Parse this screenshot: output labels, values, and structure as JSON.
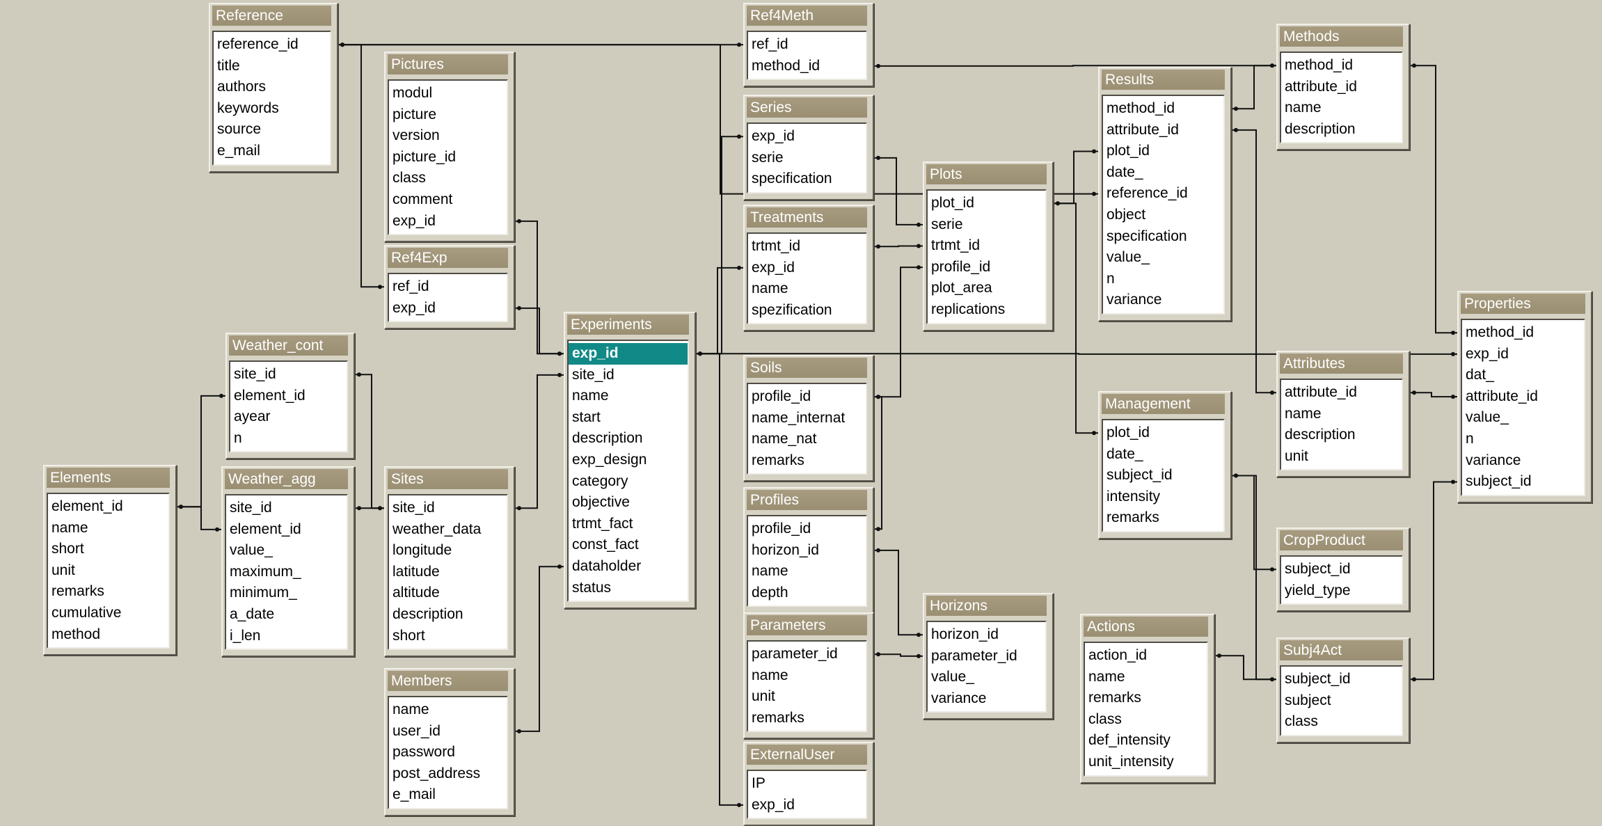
{
  "selected_field": {
    "table": "experiments",
    "field": "exp_id"
  },
  "colors": {
    "canvas": "#cfcbbd",
    "title_bar": "#a09478",
    "selection": "#118a87",
    "relationship_line": "#111111"
  },
  "tables": [
    {
      "id": "reference",
      "title": "Reference",
      "fields": [
        "reference_id",
        "title",
        "authors",
        "keywords",
        "source",
        "e_mail"
      ]
    },
    {
      "id": "pictures",
      "title": "Pictures",
      "fields": [
        "modul",
        "picture",
        "version",
        "picture_id",
        "class",
        "comment",
        "exp_id"
      ]
    },
    {
      "id": "ref4exp",
      "title": "Ref4Exp",
      "fields": [
        "ref_id",
        "exp_id"
      ]
    },
    {
      "id": "ref4meth",
      "title": "Ref4Meth",
      "fields": [
        "ref_id",
        "method_id"
      ]
    },
    {
      "id": "series",
      "title": "Series",
      "fields": [
        "exp_id",
        "serie",
        "specification"
      ]
    },
    {
      "id": "treatments",
      "title": "Treatments",
      "fields": [
        "trtmt_id",
        "exp_id",
        "name",
        "spezification"
      ]
    },
    {
      "id": "plots",
      "title": "Plots",
      "fields": [
        "plot_id",
        "serie",
        "trtmt_id",
        "profile_id",
        "plot_area",
        "replications"
      ]
    },
    {
      "id": "results",
      "title": "Results",
      "fields": [
        "method_id",
        "attribute_id",
        "plot_id",
        "date_",
        "reference_id",
        "object",
        "specification",
        "value_",
        "n",
        "variance"
      ]
    },
    {
      "id": "methods",
      "title": "Methods",
      "fields": [
        "method_id",
        "attribute_id",
        "name",
        "description"
      ]
    },
    {
      "id": "properties",
      "title": "Properties",
      "fields": [
        "method_id",
        "exp_id",
        "dat_",
        "attribute_id",
        "value_",
        "n",
        "variance",
        "subject_id"
      ]
    },
    {
      "id": "attributes",
      "title": "Attributes",
      "fields": [
        "attribute_id",
        "name",
        "description",
        "unit"
      ]
    },
    {
      "id": "experiments",
      "title": "Experiments",
      "fields": [
        "exp_id",
        "site_id",
        "name",
        "start",
        "description",
        "exp_design",
        "category",
        "objective",
        "trtmt_fact",
        "const_fact",
        "dataholder",
        "status"
      ]
    },
    {
      "id": "weather_cont",
      "title": "Weather_cont",
      "fields": [
        "site_id",
        "element_id",
        "ayear",
        "n"
      ]
    },
    {
      "id": "weather_agg",
      "title": "Weather_agg",
      "fields": [
        "site_id",
        "element_id",
        "value_",
        "maximum_",
        "minimum_",
        "a_date",
        "i_len"
      ]
    },
    {
      "id": "elements",
      "title": "Elements",
      "fields": [
        "element_id",
        "name",
        "short",
        "unit",
        "remarks",
        "cumulative",
        "method"
      ]
    },
    {
      "id": "sites",
      "title": "Sites",
      "fields": [
        "site_id",
        "weather_data",
        "longitude",
        "latitude",
        "altitude",
        "description",
        "short"
      ]
    },
    {
      "id": "members",
      "title": "Members",
      "fields": [
        "name",
        "user_id",
        "password",
        "post_address",
        "e_mail"
      ]
    },
    {
      "id": "soils",
      "title": "Soils",
      "fields": [
        "profile_id",
        "name_internat",
        "name_nat",
        "remarks"
      ]
    },
    {
      "id": "profiles",
      "title": "Profiles",
      "fields": [
        "profile_id",
        "horizon_id",
        "name",
        "depth"
      ]
    },
    {
      "id": "parameters",
      "title": "Parameters",
      "fields": [
        "parameter_id",
        "name",
        "unit",
        "remarks"
      ]
    },
    {
      "id": "horizons",
      "title": "Horizons",
      "fields": [
        "horizon_id",
        "parameter_id",
        "value_",
        "variance"
      ]
    },
    {
      "id": "externaluser",
      "title": "ExternalUser",
      "fields": [
        "IP",
        "exp_id"
      ]
    },
    {
      "id": "management",
      "title": "Management",
      "fields": [
        "plot_id",
        "date_",
        "subject_id",
        "intensity",
        "remarks"
      ]
    },
    {
      "id": "actions",
      "title": "Actions",
      "fields": [
        "action_id",
        "name",
        "remarks",
        "class",
        "def_intensity",
        "unit_intensity"
      ]
    },
    {
      "id": "cropproduct",
      "title": "CropProduct",
      "fields": [
        "subject_id",
        "yield_type"
      ]
    },
    {
      "id": "subj4act",
      "title": "Subj4Act",
      "fields": [
        "subject_id",
        "subject",
        "class"
      ]
    }
  ],
  "relationships": [
    {
      "from": "reference.reference_id",
      "to": "ref4meth.ref_id"
    },
    {
      "from": "reference.reference_id",
      "to": "ref4exp.ref_id"
    },
    {
      "from": "reference.reference_id",
      "to": "results.reference_id"
    },
    {
      "from": "ref4meth.method_id",
      "to": "methods.method_id"
    },
    {
      "from": "methods.method_id",
      "to": "results.method_id"
    },
    {
      "from": "methods.method_id",
      "to": "properties.method_id"
    },
    {
      "from": "experiments.exp_id",
      "to": "pictures.exp_id"
    },
    {
      "from": "experiments.exp_id",
      "to": "ref4exp.exp_id"
    },
    {
      "from": "experiments.exp_id",
      "to": "series.exp_id"
    },
    {
      "from": "experiments.exp_id",
      "to": "treatments.exp_id"
    },
    {
      "from": "experiments.exp_id",
      "to": "externaluser.exp_id"
    },
    {
      "from": "experiments.exp_id",
      "to": "properties.exp_id"
    },
    {
      "from": "experiments.site_id",
      "to": "sites.site_id"
    },
    {
      "from": "experiments.dataholder",
      "to": "members.user_id"
    },
    {
      "from": "sites.site_id",
      "to": "weather_cont.site_id"
    },
    {
      "from": "sites.site_id",
      "to": "weather_agg.site_id"
    },
    {
      "from": "elements.element_id",
      "to": "weather_cont.element_id"
    },
    {
      "from": "elements.element_id",
      "to": "weather_agg.element_id"
    },
    {
      "from": "series.serie",
      "to": "plots.serie"
    },
    {
      "from": "treatments.trtmt_id",
      "to": "plots.trtmt_id"
    },
    {
      "from": "soils.profile_id",
      "to": "plots.profile_id"
    },
    {
      "from": "soils.profile_id",
      "to": "profiles.profile_id"
    },
    {
      "from": "profiles.horizon_id",
      "to": "horizons.horizon_id"
    },
    {
      "from": "parameters.parameter_id",
      "to": "horizons.parameter_id"
    },
    {
      "from": "plots.plot_id",
      "to": "results.plot_id"
    },
    {
      "from": "plots.plot_id",
      "to": "management.plot_id"
    },
    {
      "from": "attributes.attribute_id",
      "to": "results.attribute_id"
    },
    {
      "from": "attributes.attribute_id",
      "to": "properties.attribute_id"
    },
    {
      "from": "management.subject_id",
      "to": "cropproduct.subject_id"
    },
    {
      "from": "management.subject_id",
      "to": "subj4act.subject_id"
    },
    {
      "from": "actions.action_id",
      "to": "subj4act.subject_id"
    },
    {
      "from": "subj4act.subject_id",
      "to": "properties.subject_id"
    }
  ]
}
